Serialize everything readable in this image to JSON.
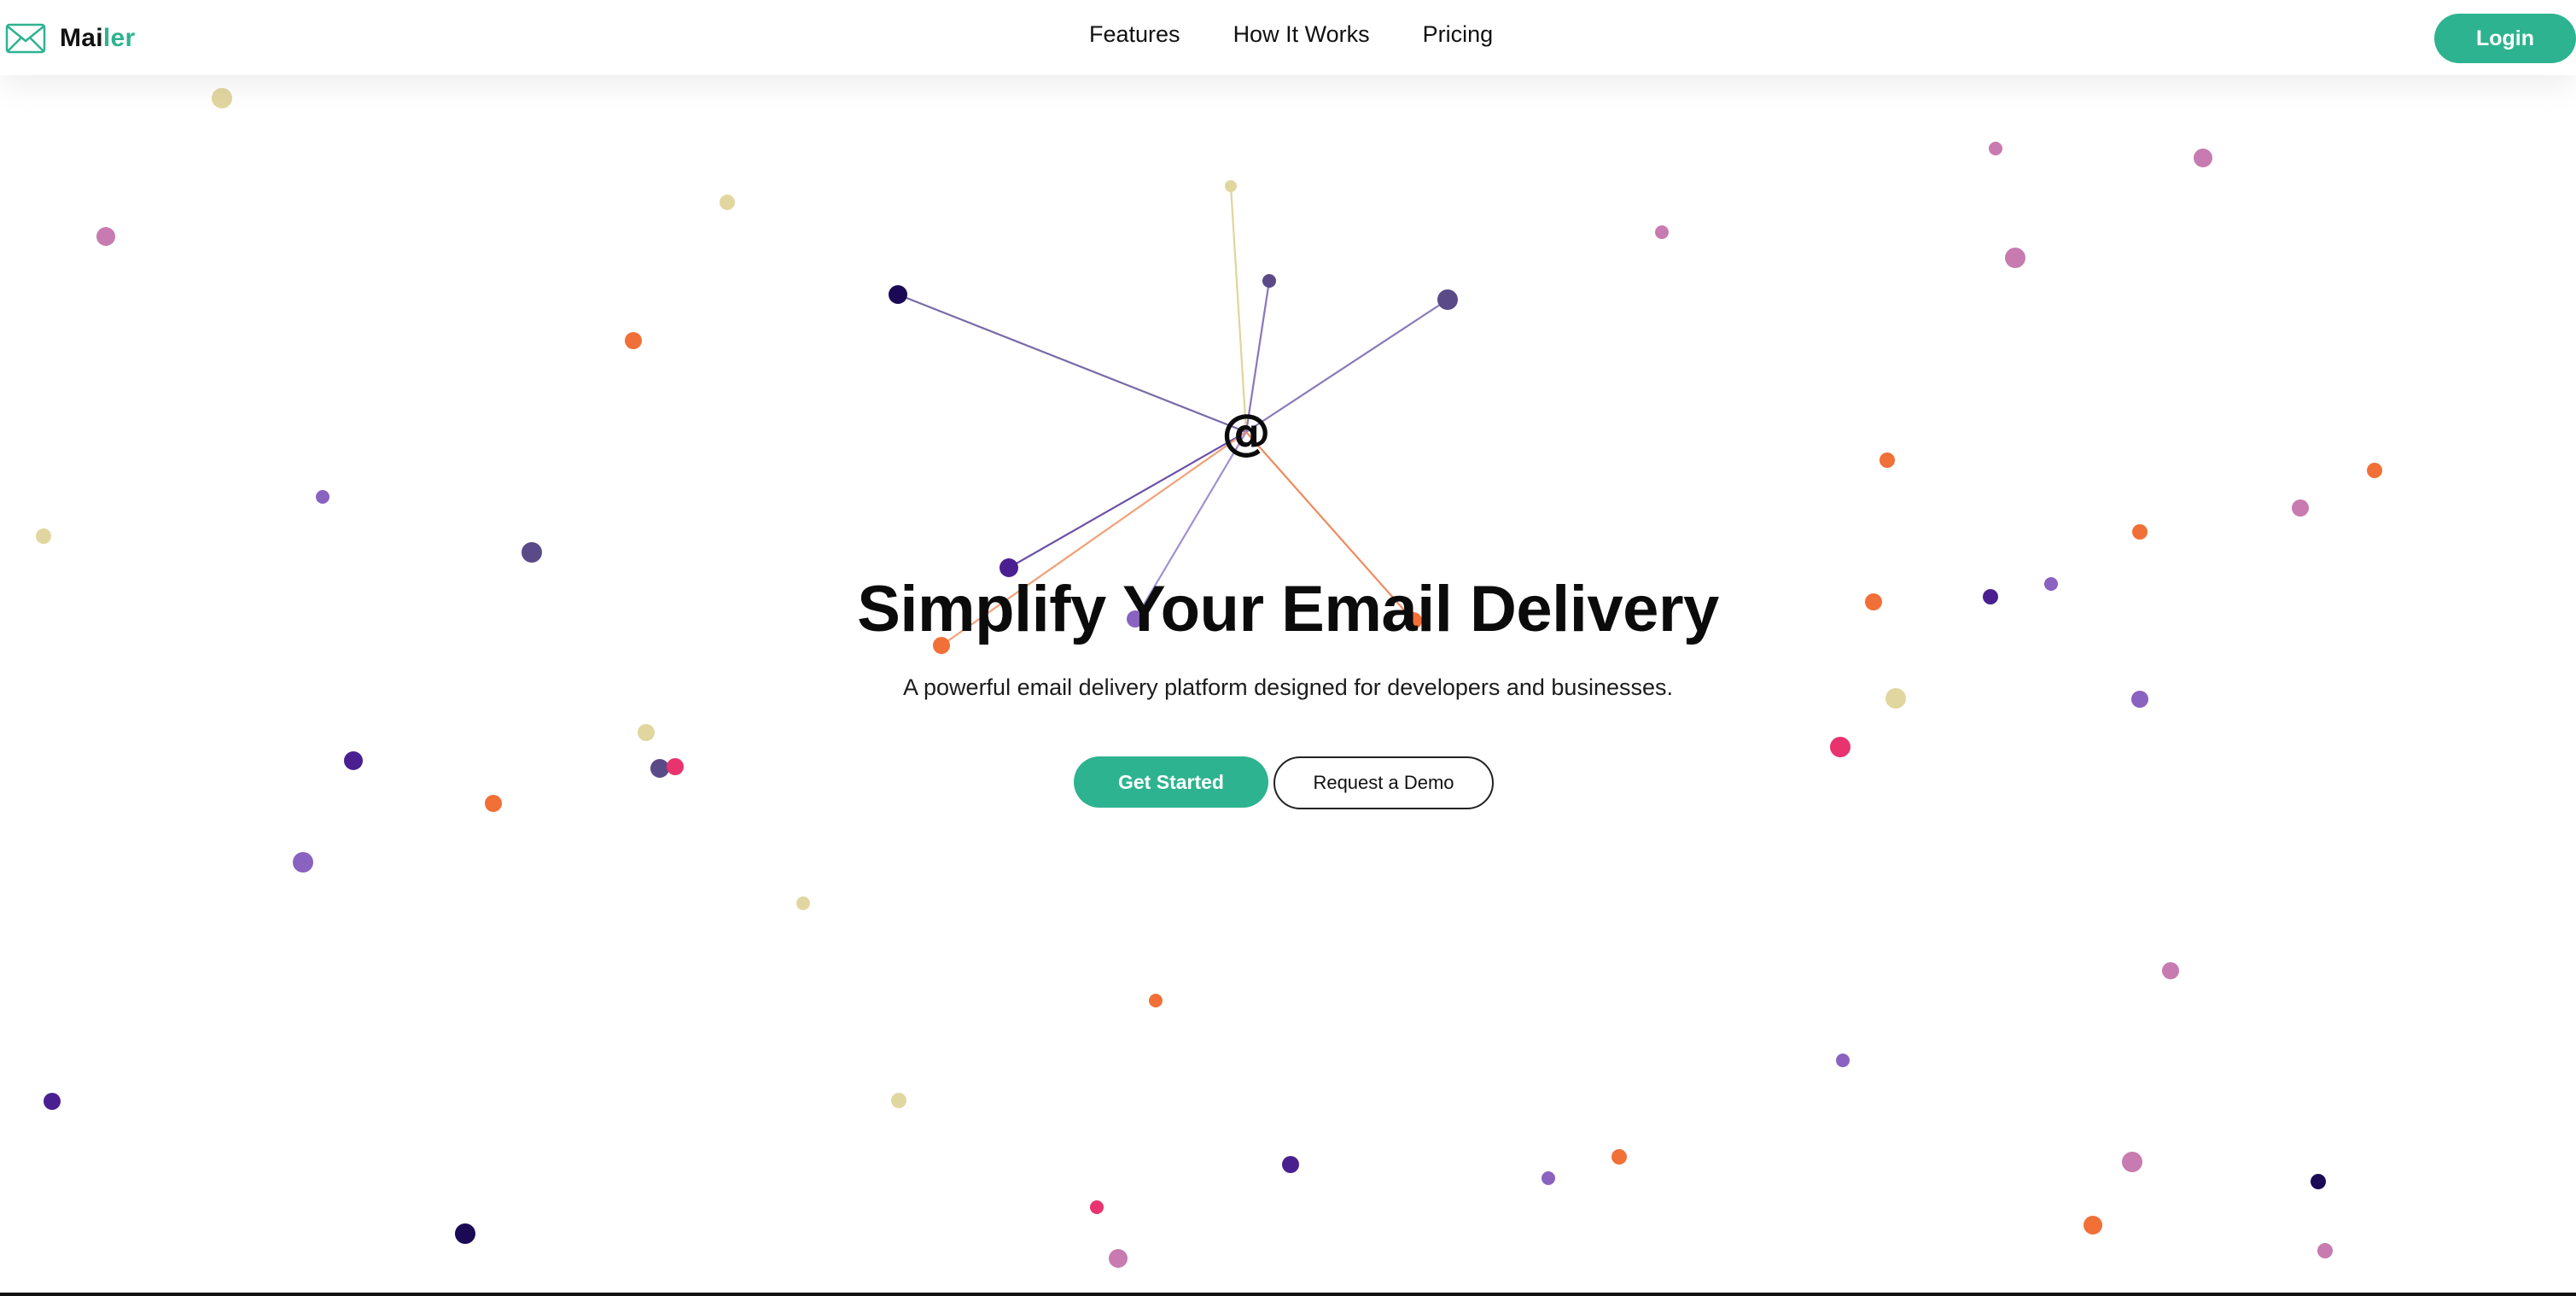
{
  "brand": {
    "name_main": "Mai",
    "name_accent": "ler",
    "icon": "envelope-icon",
    "accent_color": "#2db38f"
  },
  "nav": {
    "items": [
      "Features",
      "How It Works",
      "Pricing"
    ],
    "login_label": "Login"
  },
  "hero": {
    "title": "Simplify Your Email Delivery",
    "subtitle": "A powerful email delivery platform designed for developers and businesses.",
    "primary_cta": "Get Started",
    "secondary_cta": "Request a Demo",
    "hub_symbol": "@"
  },
  "colors": {
    "accent": "#2db38f",
    "dot_palette": [
      "#e2d6a0",
      "#c77bb0",
      "#f07038",
      "#8a62c0",
      "#5a4a88",
      "#4a2090",
      "#1a0a55",
      "#e8336e"
    ]
  }
}
